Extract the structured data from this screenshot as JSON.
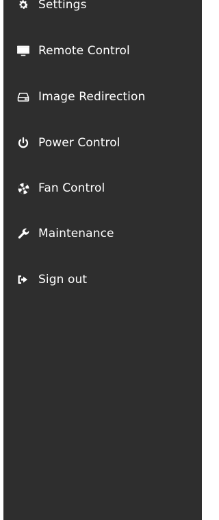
{
  "sidebar": {
    "background": "#2e2e2e",
    "items": [
      {
        "label": "Settings",
        "icon": "gear-icon"
      },
      {
        "label": "Remote Control",
        "icon": "monitor-icon"
      },
      {
        "label": "Image Redirection",
        "icon": "hard-drive-icon"
      },
      {
        "label": "Power Control",
        "icon": "power-icon"
      },
      {
        "label": "Fan Control",
        "icon": "fan-icon"
      },
      {
        "label": "Maintenance",
        "icon": "wrench-icon"
      },
      {
        "label": "Sign out",
        "icon": "sign-out-icon"
      }
    ]
  }
}
